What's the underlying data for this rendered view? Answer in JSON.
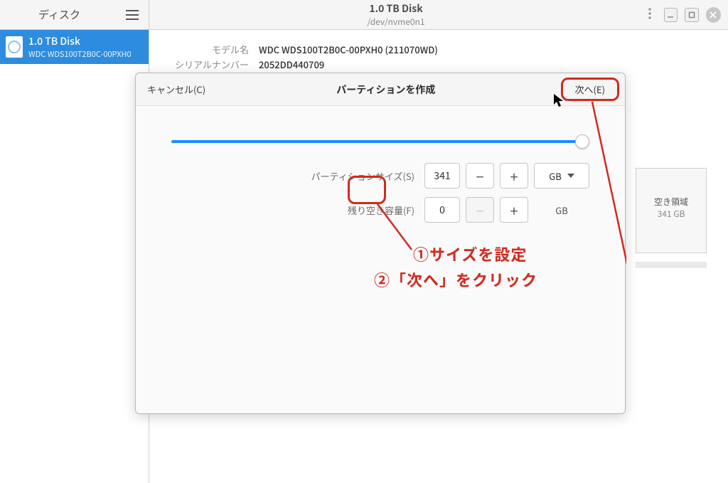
{
  "header": {
    "app_title": "ディスク",
    "disk_title": "1.0 TB Disk",
    "disk_path": "/dev/nvme0n1"
  },
  "sidebar": {
    "item": {
      "l1": "1.0 TB Disk",
      "l2": "WDC WDS100T2B0C-00PXH0"
    }
  },
  "info": {
    "model_k": "モデル名",
    "model_v": "WDC WDS100T2B0C-00PXH0 (211070WD)",
    "serial_k": "シリアルナンバー",
    "serial_v": "2052DD440709"
  },
  "free": {
    "l1": "空き領域",
    "l2": "341 GB"
  },
  "dialog": {
    "cancel": "キャンセル(C)",
    "title": "パーティションを作成",
    "next": "次へ(E)",
    "size_label": "パーティションサイズ(S)",
    "size_value": "341",
    "free_label": "残り空き容量(F)",
    "free_value": "0",
    "unit": "GB"
  },
  "annotations": {
    "a1": "①サイズを設定",
    "a2": "②「次へ」をクリック"
  }
}
